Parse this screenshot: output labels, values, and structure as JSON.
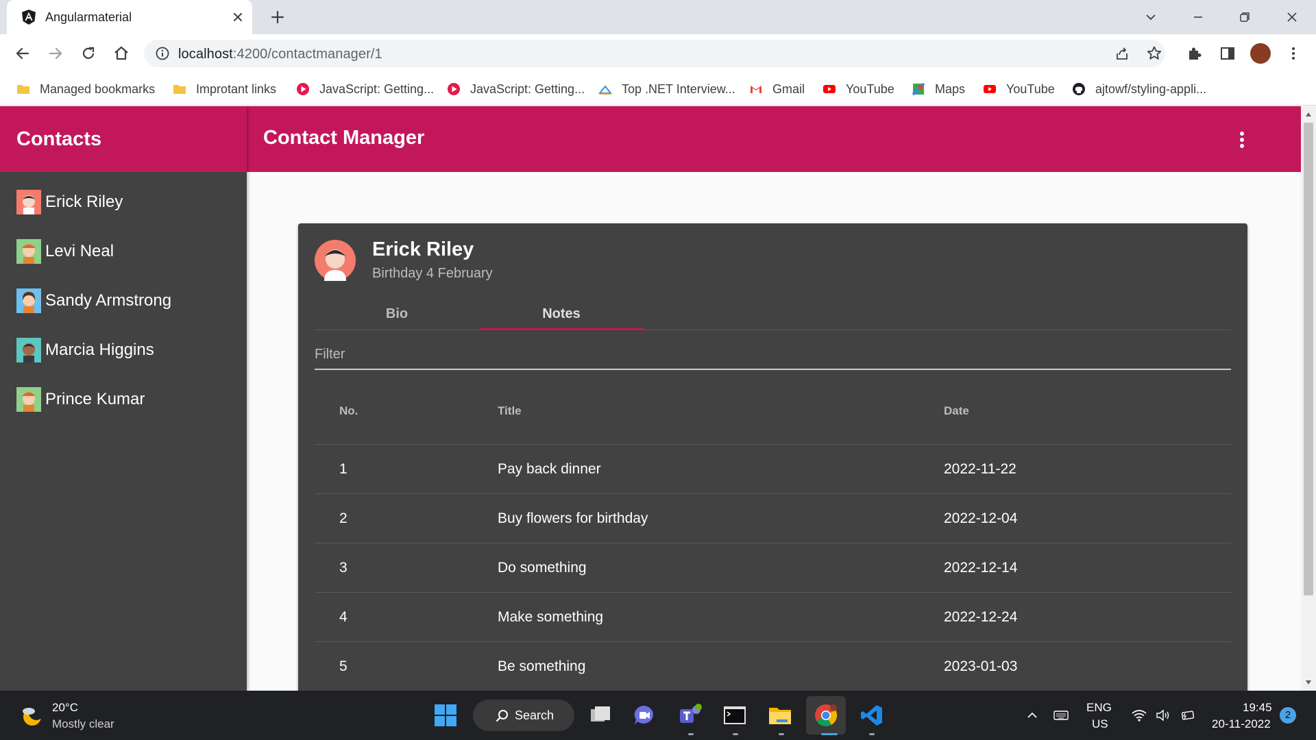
{
  "browser": {
    "tab": {
      "title": "Angularmaterial",
      "favicon": "angular-icon"
    },
    "url": {
      "host": "localhost",
      "rest": ":4200/contactmanager/1"
    },
    "bookmarks": [
      {
        "label": "Managed bookmarks",
        "icon": "folder-icon"
      },
      {
        "label": "Improtant links",
        "icon": "folder-icon"
      },
      {
        "label": "JavaScript: Getting...",
        "icon": "play-icon"
      },
      {
        "label": "JavaScript: Getting...",
        "icon": "play-icon"
      },
      {
        "label": "Top .NET Interview...",
        "icon": "site-icon"
      },
      {
        "label": "Gmail",
        "icon": "gmail-icon"
      },
      {
        "label": "YouTube",
        "icon": "youtube-icon"
      },
      {
        "label": "Maps",
        "icon": "maps-icon"
      },
      {
        "label": "YouTube",
        "icon": "youtube-icon"
      },
      {
        "label": "ajtowf/styling-appli...",
        "icon": "github-icon"
      }
    ]
  },
  "app": {
    "sidenav_title": "Contacts",
    "header_title": "Contact Manager",
    "contacts": [
      {
        "name": "Erick Riley"
      },
      {
        "name": "Levi Neal"
      },
      {
        "name": "Sandy Armstrong"
      },
      {
        "name": "Marcia Higgins"
      },
      {
        "name": "Prince Kumar"
      }
    ],
    "card": {
      "name": "Erick Riley",
      "subtitle": "Birthday 4 February",
      "tabs": [
        "Bio",
        "Notes"
      ],
      "active_tab": "Notes",
      "filter_label": "Filter",
      "columns": [
        "No.",
        "Title",
        "Date"
      ],
      "rows": [
        {
          "no": "1",
          "title": "Pay back dinner",
          "date": "2022-11-22"
        },
        {
          "no": "2",
          "title": "Buy flowers for birthday",
          "date": "2022-12-04"
        },
        {
          "no": "3",
          "title": "Do something",
          "date": "2022-12-14"
        },
        {
          "no": "4",
          "title": "Make something",
          "date": "2022-12-24"
        },
        {
          "no": "5",
          "title": "Be something",
          "date": "2023-01-03"
        }
      ]
    }
  },
  "taskbar": {
    "weather": {
      "temp": "20°C",
      "desc": "Mostly clear"
    },
    "search_label": "Search",
    "lang": "ENG",
    "region": "US",
    "time": "19:45",
    "date": "20-11-2022",
    "notifications": "2"
  },
  "colors": {
    "primary": "#c2185b",
    "sidenav": "#424242",
    "card": "#424242"
  }
}
